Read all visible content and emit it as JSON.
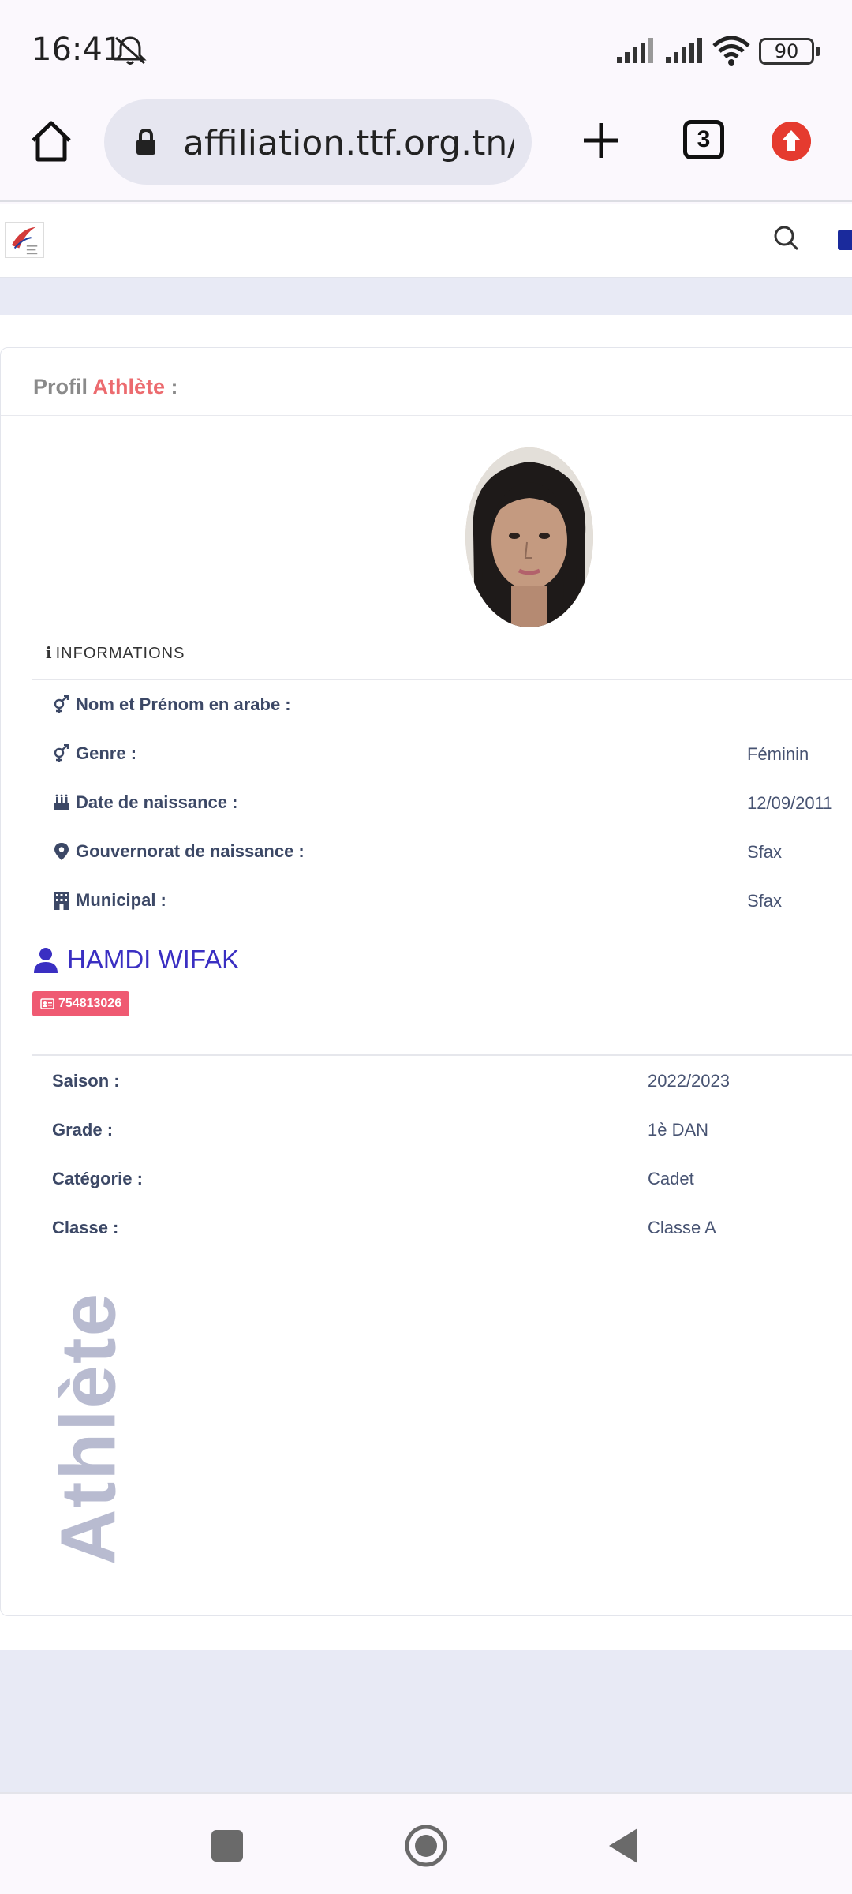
{
  "status_bar": {
    "time": "16:41",
    "battery": "90"
  },
  "browser": {
    "url": "affiliation.ttf.org.tn/fic",
    "tab_count": "3"
  },
  "card": {
    "title_prefix": "Profil",
    "title_accent": "Athlète",
    "title_suffix": " :",
    "info_heading": "INFORMATIONS",
    "info_rows": [
      {
        "label": "Nom et Prénom en arabe :",
        "value": "",
        "icon": "gender-icon"
      },
      {
        "label": "Genre :",
        "value": "Féminin",
        "icon": "gender-icon"
      },
      {
        "label": "Date de naissance :",
        "value": "12/09/2011",
        "icon": "birthday-cake-icon"
      },
      {
        "label": "Gouvernorat de naissance :",
        "value": "Sfax",
        "icon": "map-marker-icon"
      },
      {
        "label": "Municipal :",
        "value": "Sfax",
        "icon": "building-icon"
      }
    ],
    "athlete_name": "HAMDI WIFAK",
    "license_number": "754813026",
    "season_rows": [
      {
        "label": "Saison :",
        "value": "2022/2023"
      },
      {
        "label": "Grade :",
        "value": "1è DAN"
      },
      {
        "label": "Catégorie :",
        "value": "Cadet"
      },
      {
        "label": "Classe :",
        "value": "Classe A"
      }
    ],
    "watermark": "Athlète"
  },
  "colors": {
    "accent": "#ec6b6f",
    "name": "#3a2fc2",
    "badge": "#ef5a72",
    "update": "#e53b2f"
  }
}
